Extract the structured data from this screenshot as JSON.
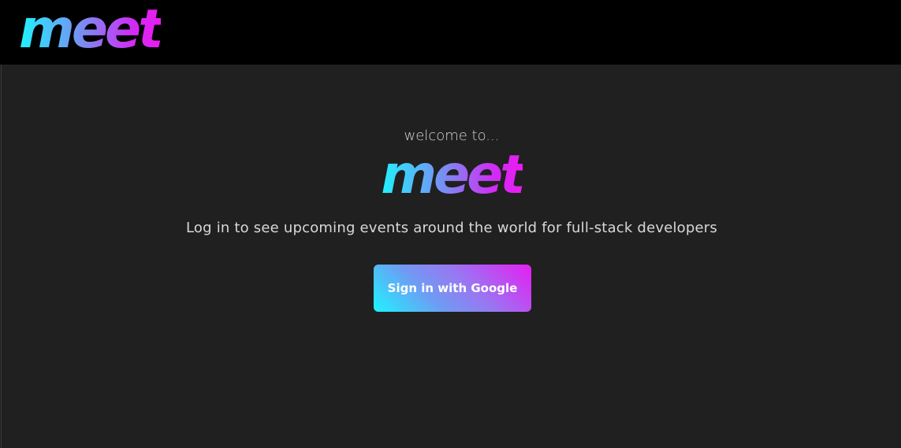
{
  "header": {
    "logo_text": "meet"
  },
  "main": {
    "welcome_text": "welcome to...",
    "logo_text": "meet",
    "subtitle": "Log in to see upcoming events around the world for full-stack developers",
    "signin_label": "Sign in with Google"
  },
  "colors": {
    "page_background": "#202020",
    "header_background": "#000000",
    "gradient_start": "#1ff3ff",
    "gradient_end": "#e91cf0"
  }
}
